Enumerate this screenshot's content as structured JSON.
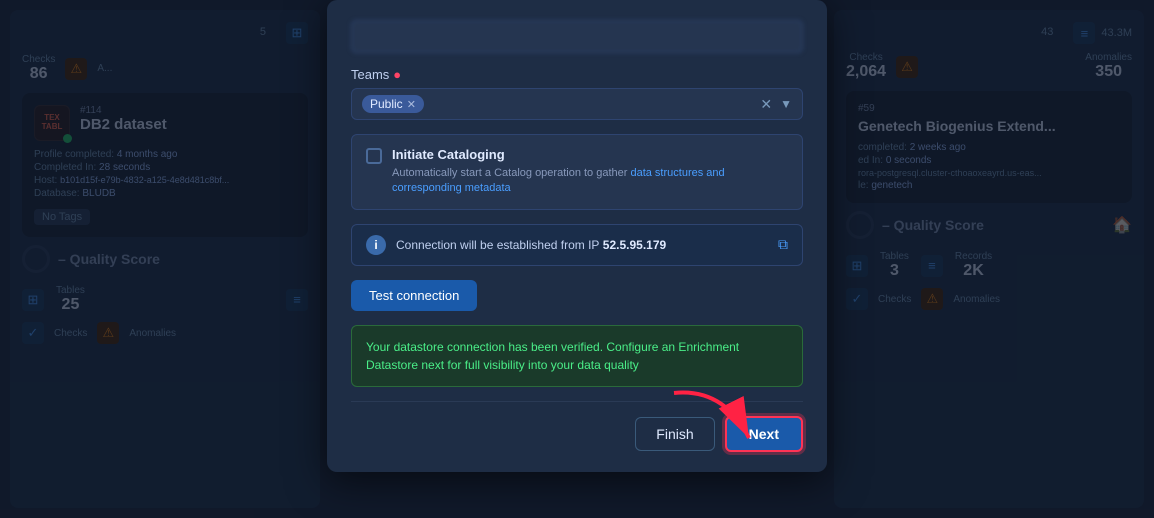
{
  "left_card": {
    "number": "#114",
    "badge_text": "TEX\nTABL",
    "title": "DB2 dataset",
    "profile_completed": "Profile completed:",
    "profile_time": "4 months ago",
    "completed_in": "Completed In:",
    "completed_val": "28 seconds",
    "host_label": "Host:",
    "host_val": "b101d15f-e79b-4832-a125-4e8d481c8bf...",
    "database_label": "Database:",
    "database_val": "BLUDB",
    "no_tags": "No Tags",
    "quality_label": "– Quality Score",
    "tables_label": "Tables",
    "tables_val": "25",
    "checks_label": "Checks",
    "anomalies_label": "Anomalies"
  },
  "right_card": {
    "number": "#59",
    "title": "Genetech Biogenius Extend...",
    "top_stat1_label": "43",
    "top_stat2_label": "43.3M",
    "checks_label": "Checks",
    "checks_val": "2,064",
    "anomalies_label": "Anomalies",
    "anomalies_val": "350",
    "completed_label": "completed:",
    "completed_val": "2 weeks ago",
    "in_label": "ed In:",
    "in_val": "0 seconds",
    "host_fragment": "rora-postgresql.cluster-cthoaoxeayrd.us-eas...",
    "le_label": "le:",
    "le_val": "genetech",
    "quality_label": "– Quality Score",
    "icon_label": "🏠",
    "tables_label": "Tables",
    "tables_val": "3",
    "records_label": "Records",
    "records_val": "2K",
    "checks_bot_label": "Checks",
    "anomalies_bot_label": "Anomalies"
  },
  "modal": {
    "input_placeholder": "",
    "teams_label": "Teams",
    "teams_required": "●",
    "team_pill": "Public",
    "initiate_cataloging_title": "Initiate Cataloging",
    "initiate_cataloging_desc1": "Automatically start a Catalog operation to gather data",
    "initiate_cataloging_desc2": "structures and corresponding metadata",
    "initiate_cataloging_highlight": "data structures and corresponding metadata",
    "info_text_prefix": "Connection will be established from IP",
    "info_ip": "52.5.95.179",
    "test_connection_label": "Test connection",
    "success_text": "Your datastore connection has been verified. Configure an Enrichment Datastore next for full visibility into your data quality",
    "finish_label": "Finish",
    "next_label": "Next"
  },
  "colors": {
    "accent_blue": "#1a5aaa",
    "danger_red": "#ff3355",
    "success_green": "#4aee88",
    "bg_dark": "#1a2233",
    "card_bg": "#1e2d45"
  }
}
